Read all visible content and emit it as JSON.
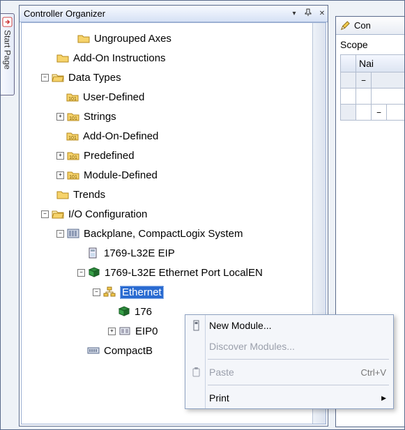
{
  "startpage": {
    "label": "Start Page"
  },
  "toolwin": {
    "title": "Controller Organizer",
    "menu_glyph": "▾",
    "pin_glyph": "⇕",
    "close_glyph": "✕"
  },
  "tree": {
    "ungrouped_axes": "Ungrouped Axes",
    "addon_instr": "Add-On Instructions",
    "data_types": "Data Types",
    "user_defined": "User-Defined",
    "strings": "Strings",
    "addon_defined": "Add-On-Defined",
    "predefined": "Predefined",
    "module_defined": "Module-Defined",
    "trends": "Trends",
    "io_config": "I/O Configuration",
    "backplane": "Backplane, CompactLogix System",
    "cpu": "1769-L32E EIP",
    "ethport": "1769-L32E Ethernet Port LocalEN",
    "ethernet": "Ethernet",
    "child176": "176",
    "childeip": "EIP0",
    "compactb": "CompactB"
  },
  "ctx": {
    "new_module": "New Module...",
    "discover": "Discover Modules...",
    "paste": "Paste",
    "paste_shortcut": "Ctrl+V",
    "print": "Print"
  },
  "right": {
    "tab_label": "Con",
    "scope": "Scope",
    "name_col": "Nai"
  }
}
